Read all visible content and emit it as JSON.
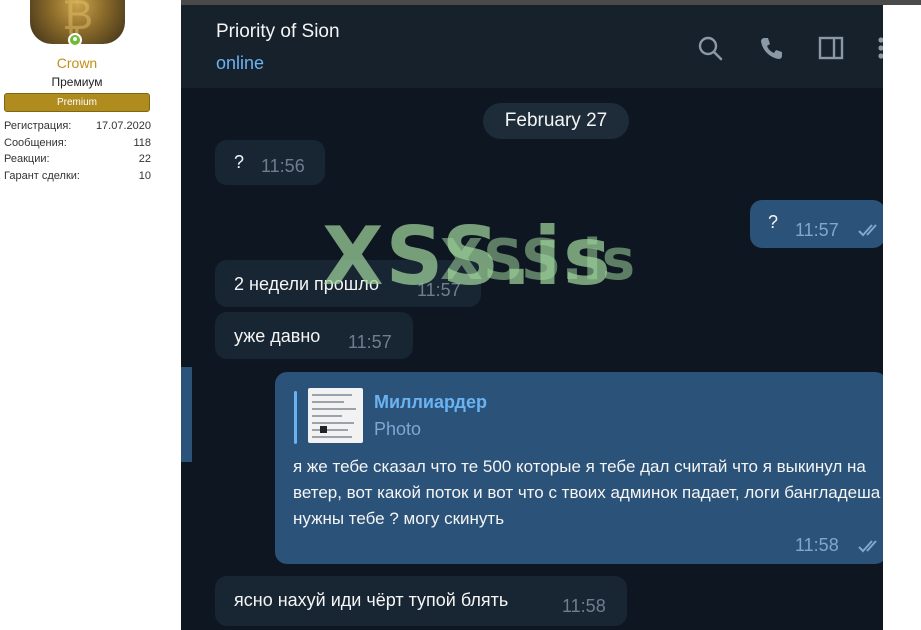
{
  "profile": {
    "username": "Crown",
    "title": "Премиум",
    "badge": "Premium",
    "stats": [
      {
        "label": "Регистрация:",
        "value": "17.07.2020"
      },
      {
        "label": "Сообщения:",
        "value": "118"
      },
      {
        "label": "Реакции:",
        "value": "22"
      },
      {
        "label": "Гарант сделки:",
        "value": "10"
      }
    ]
  },
  "chat": {
    "title": "Priority of Sion",
    "status": "online",
    "header_icons": [
      "search-icon",
      "phone-icon",
      "sidebar-toggle-icon",
      "more-menu-icon"
    ],
    "date_separator": "February 27",
    "messages": [
      {
        "direction": "in",
        "text": "?",
        "time": "11:56"
      },
      {
        "direction": "out",
        "text": "?",
        "time": "11:57",
        "read": true
      },
      {
        "direction": "in",
        "text": "2 недели прошло",
        "time": "11:57"
      },
      {
        "direction": "in",
        "text": "уже давно",
        "time": "11:57"
      },
      {
        "direction": "out",
        "reply_to": {
          "name": "Миллиардер",
          "type": "Photo"
        },
        "text": "я же тебе сказал что те 500 которые я тебе дал считай что я выкинул на ветер, вот какой поток и вот что с твоих админок падает, логи бангладеша нужны тебе ? могу скинуть",
        "time": "11:58",
        "read": true
      },
      {
        "direction": "in",
        "text": "ясно нахуй иди чёрт тупой блять",
        "time": "11:58"
      }
    ]
  },
  "watermark": "XSS.is",
  "colors": {
    "chat_bg": "#0e1621",
    "header_bg": "#17212b",
    "incoming_bubble": "#182533",
    "outgoing_bubble": "#2b5278",
    "accent": "#6ab3f3",
    "premium_gold": "#b08c1e",
    "username_gold": "#c28f1a"
  }
}
